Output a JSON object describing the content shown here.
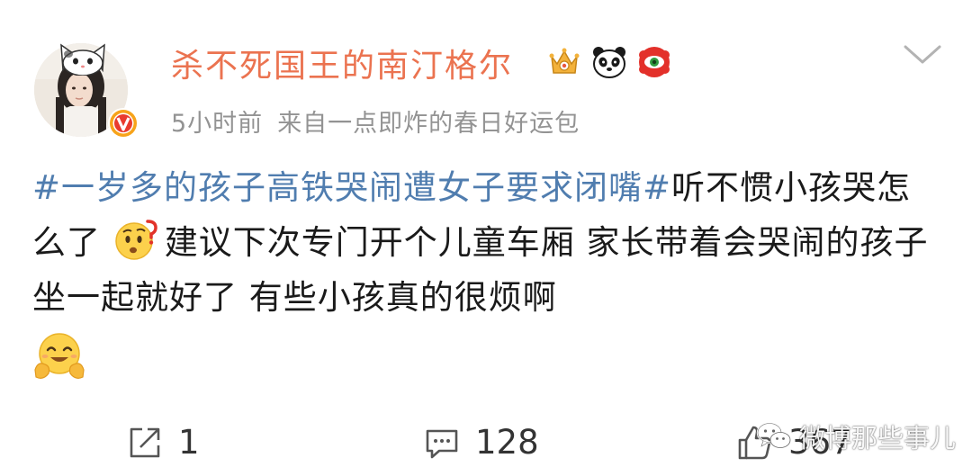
{
  "post": {
    "username": "杀不死国王的南汀格尔",
    "time": "5小时前",
    "source": "来自一点即炸的春日好运包",
    "hashtag": "#一岁多的孩子高铁哭闹遭女子要求闭嘴#",
    "text_part1": "听不惯小孩哭怎么了",
    "text_part2": "建议下次专门开个儿童车厢 家长带着会哭闹的孩子坐一起就好了 有些小孩真的很烦啊"
  },
  "badges": [
    "crown-badge-icon",
    "panda-badge-icon",
    "red-eye-badge-icon"
  ],
  "actions": {
    "share_count": "1",
    "comment_count": "128",
    "like_count": "367"
  },
  "watermark": {
    "label": "微博那些事儿"
  },
  "colors": {
    "username": "#eb7350",
    "hashtag": "#507daf",
    "meta": "#939393",
    "verified": "#f7a31a"
  }
}
